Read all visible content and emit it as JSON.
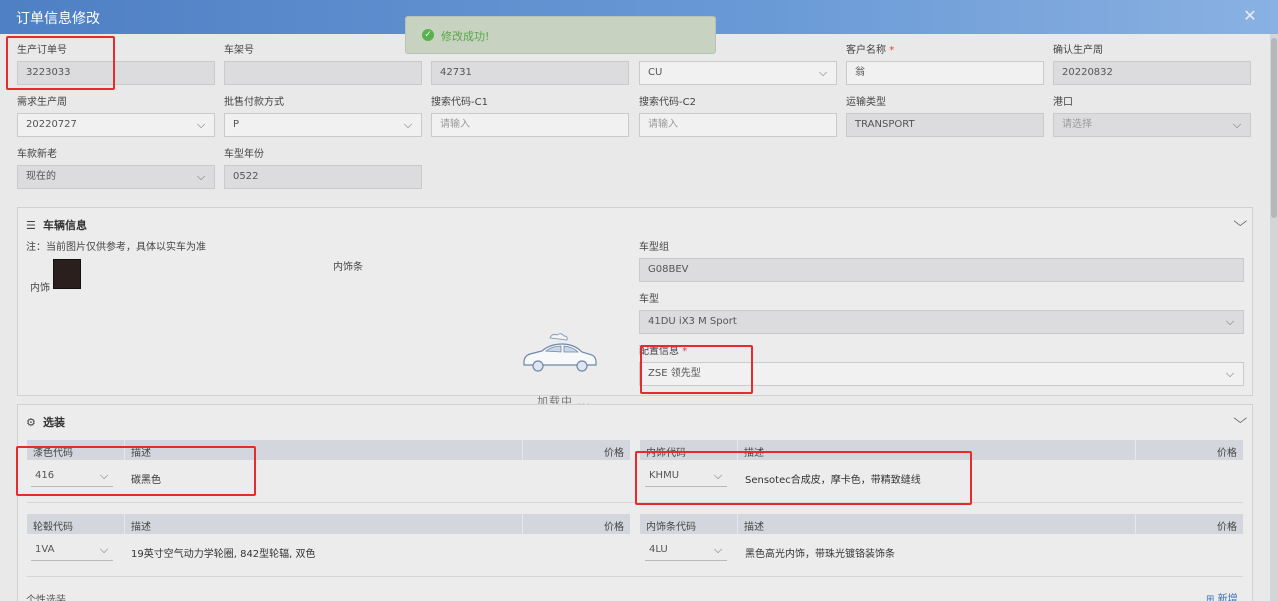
{
  "modal": {
    "title": "订单信息修改",
    "close_icon": "✕"
  },
  "toast": {
    "text": "修改成功!",
    "icon": "check-circle-icon",
    "color": "#59a64a"
  },
  "form": {
    "production_order_no": {
      "label": "生产订单号",
      "value": "3223033"
    },
    "vin": {
      "label": "车架号",
      "value": ""
    },
    "field3": {
      "value": "42731"
    },
    "field4": {
      "value": "CU"
    },
    "customer_name": {
      "label": "客户名称",
      "required": "*",
      "value": "翁"
    },
    "confirmed_week": {
      "label": "确认生产周",
      "value": "20220832"
    },
    "requested_week": {
      "label": "需求生产周",
      "value": "20220727"
    },
    "payment_method": {
      "label": "批售付款方式",
      "value": "P"
    },
    "search_code_c1": {
      "label": "搜索代码-C1",
      "placeholder": "请输入"
    },
    "search_code_c2": {
      "label": "搜索代码-C2",
      "placeholder": "请输入"
    },
    "transport_type": {
      "label": "运输类型",
      "value": "TRANSPORT"
    },
    "port": {
      "label": "港口",
      "placeholder": "请选择"
    },
    "model_status": {
      "label": "车款新老",
      "value": "现在的"
    },
    "model_year": {
      "label": "车型年份",
      "value": "0522"
    }
  },
  "vehicle_panel": {
    "title": "车辆信息",
    "note": "注：当前图片仅供参考，具体以实车为准",
    "interior_label": "内饰",
    "trim_label": "内饰条",
    "model_group": {
      "label": "车型组",
      "value": "G08BEV"
    },
    "model": {
      "label": "车型",
      "value": "41DU iX3 M Sport"
    },
    "config": {
      "label": "配置信息",
      "required": "*",
      "value": "ZSE 领先型"
    },
    "loading": "加载中 ..."
  },
  "options_panel": {
    "title": "选装",
    "paint": {
      "h_code": "漆色代码",
      "h_desc": "描述",
      "h_price": "价格",
      "code": "416",
      "desc": "碳黑色"
    },
    "upholstery": {
      "h_code": "内饰代码",
      "h_desc": "描述",
      "h_price": "价格",
      "code": "KHMU",
      "desc": "Sensotec合成皮，摩卡色，带精致缝线"
    },
    "wheels": {
      "h_code": "轮毂代码",
      "h_desc": "描述",
      "h_price": "价格",
      "code": "1VA",
      "desc": "19英寸空气动力学轮圈, 842型轮辐, 双色"
    },
    "trim": {
      "h_code": "内饰条代码",
      "h_desc": "描述",
      "h_price": "价格",
      "code": "4LU",
      "desc": "黑色高光内饰，带珠光镀铬装饰条"
    }
  },
  "bottom": {
    "label": "个性选装",
    "add_label": "新增"
  },
  "colors": {
    "header": "#5a88c9",
    "highlight": "#e52b2b",
    "success": "#58b24a"
  }
}
